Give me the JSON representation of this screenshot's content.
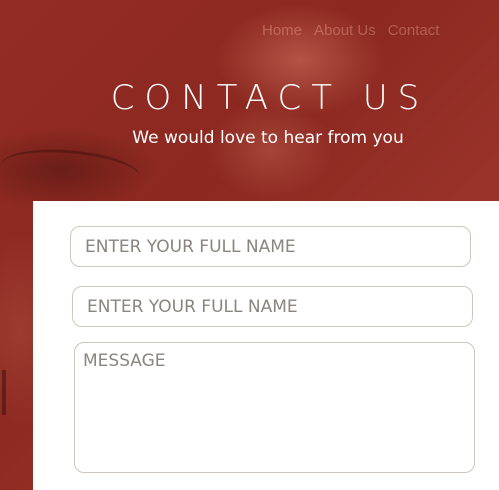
{
  "nav": {
    "items": [
      {
        "label": "Home"
      },
      {
        "label": "About Us"
      },
      {
        "label": "Contact"
      }
    ]
  },
  "hero": {
    "title": "CONTACT US",
    "subtitle": "We would love to hear from you"
  },
  "form": {
    "name_placeholder": "ENTER YOUR FULL NAME",
    "second_placeholder": "ENTER YOUR FULL NAME",
    "message_placeholder": "MESSAGE"
  },
  "colors": {
    "hero_background": "#8e2a22",
    "panel_background": "#ffffff",
    "field_border": "#cfc7bd",
    "placeholder_text": "#8a8580"
  }
}
